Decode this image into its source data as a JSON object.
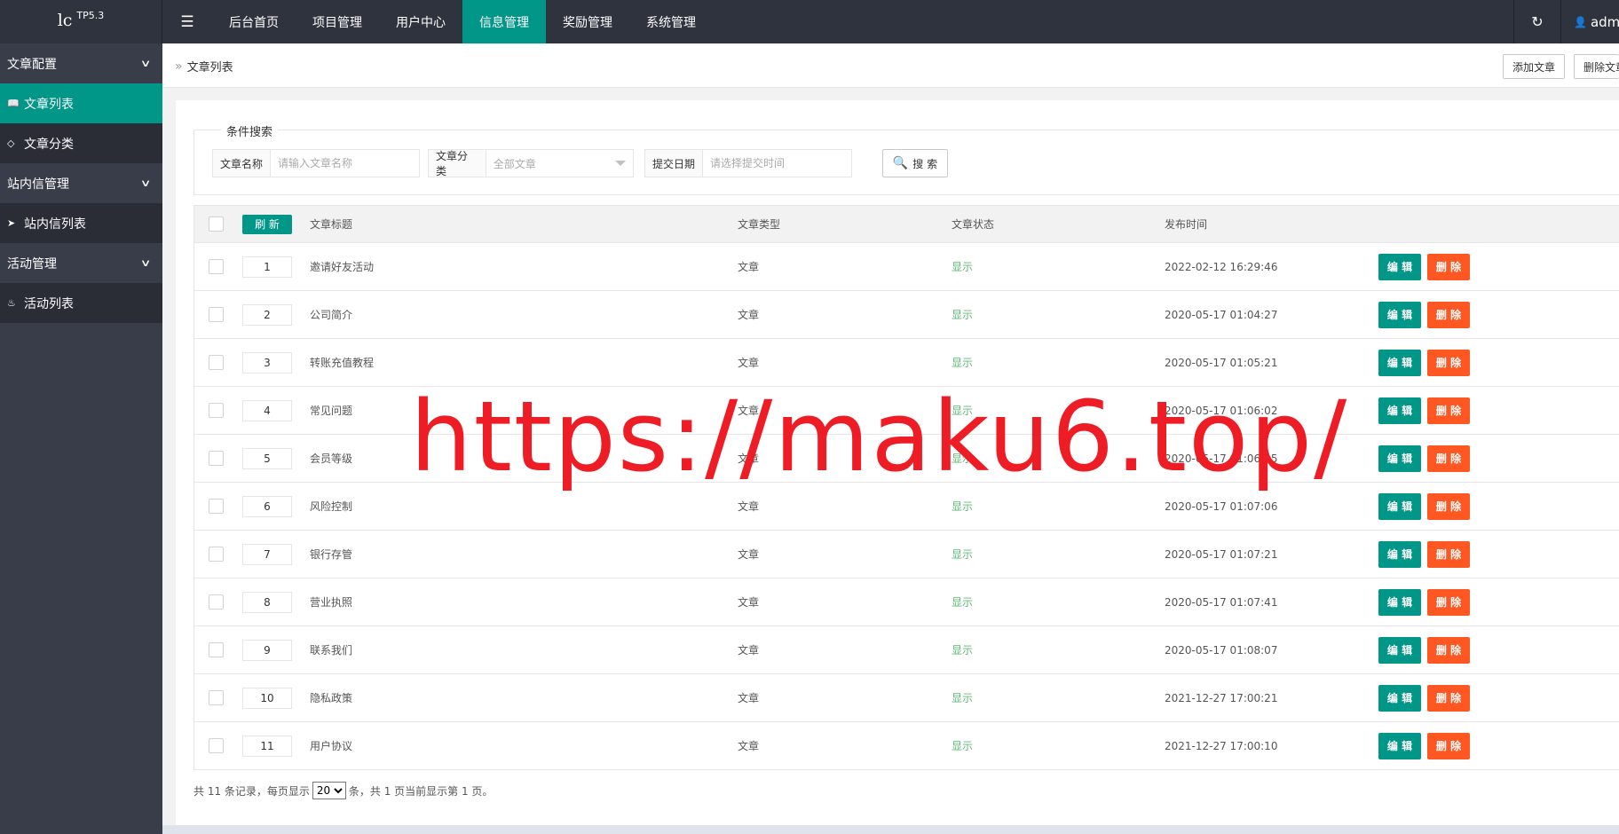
{
  "header": {
    "logo_main": "lc",
    "logo_version": "TP5.3",
    "menu_icon": "hamburger-icon",
    "nav": [
      {
        "label": "后台首页",
        "active": false
      },
      {
        "label": "项目管理",
        "active": false
      },
      {
        "label": "用户中心",
        "active": false
      },
      {
        "label": "信息管理",
        "active": true
      },
      {
        "label": "奖励管理",
        "active": false
      },
      {
        "label": "系统管理",
        "active": false
      }
    ],
    "user_name": "admin"
  },
  "sidebar": {
    "groups": [
      {
        "label": "文章配置",
        "items": [
          {
            "label": "文章列表",
            "icon": "book-icon",
            "active": true
          },
          {
            "label": "文章分类",
            "icon": "tag-icon",
            "active": false
          }
        ]
      },
      {
        "label": "站内信管理",
        "items": [
          {
            "label": "站内信列表",
            "icon": "send-icon",
            "active": false
          }
        ]
      },
      {
        "label": "活动管理",
        "items": [
          {
            "label": "活动列表",
            "icon": "fire-icon",
            "active": false
          }
        ]
      }
    ]
  },
  "breadcrumb": {
    "current": "文章列表"
  },
  "toolbar": {
    "add_label": "添加文章",
    "delete_label": "删除文章"
  },
  "search": {
    "legend": "条件搜索",
    "name_label": "文章名称",
    "name_placeholder": "请输入文章名称",
    "category_label": "文章分类",
    "category_value": "全部文章",
    "date_label": "提交日期",
    "date_placeholder": "请选择提交时间",
    "button_label": "搜 索"
  },
  "table": {
    "refresh_label": "刷 新",
    "columns": {
      "title": "文章标题",
      "type": "文章类型",
      "status": "文章状态",
      "time": "发布时间"
    },
    "edit_label": "编 辑",
    "delete_label": "删 除",
    "status_color": "#5fb878",
    "rows": [
      {
        "sort": "1",
        "title": "邀请好友活动",
        "type": "文章",
        "status": "显示",
        "time": "2022-02-12 16:29:46"
      },
      {
        "sort": "2",
        "title": "公司简介",
        "type": "文章",
        "status": "显示",
        "time": "2020-05-17 01:04:27"
      },
      {
        "sort": "3",
        "title": "转账充值教程",
        "type": "文章",
        "status": "显示",
        "time": "2020-05-17 01:05:21"
      },
      {
        "sort": "4",
        "title": "常见问题",
        "type": "文章",
        "status": "显示",
        "time": "2020-05-17 01:06:02"
      },
      {
        "sort": "5",
        "title": "会员等级",
        "type": "文章",
        "status": "显示",
        "time": "2020-05-17 01:06:45"
      },
      {
        "sort": "6",
        "title": "风险控制",
        "type": "文章",
        "status": "显示",
        "time": "2020-05-17 01:07:06"
      },
      {
        "sort": "7",
        "title": "银行存管",
        "type": "文章",
        "status": "显示",
        "time": "2020-05-17 01:07:21"
      },
      {
        "sort": "8",
        "title": "营业执照",
        "type": "文章",
        "status": "显示",
        "time": "2020-05-17 01:07:41"
      },
      {
        "sort": "9",
        "title": "联系我们",
        "type": "文章",
        "status": "显示",
        "time": "2020-05-17 01:08:07"
      },
      {
        "sort": "10",
        "title": "隐私政策",
        "type": "文章",
        "status": "显示",
        "time": "2021-12-27 17:00:21"
      },
      {
        "sort": "11",
        "title": "用户协议",
        "type": "文章",
        "status": "显示",
        "time": "2021-12-27 17:00:10"
      }
    ]
  },
  "pager": {
    "prefix": "共 11 条记录，每页显示",
    "page_size": "20",
    "suffix": "条，共 1 页当前显示第 1 页。"
  },
  "watermark": "https://maku6.top/",
  "colors": {
    "accent": "#009688",
    "danger": "#ff5722",
    "dark": "#393d49",
    "topbar": "#2f333e"
  }
}
